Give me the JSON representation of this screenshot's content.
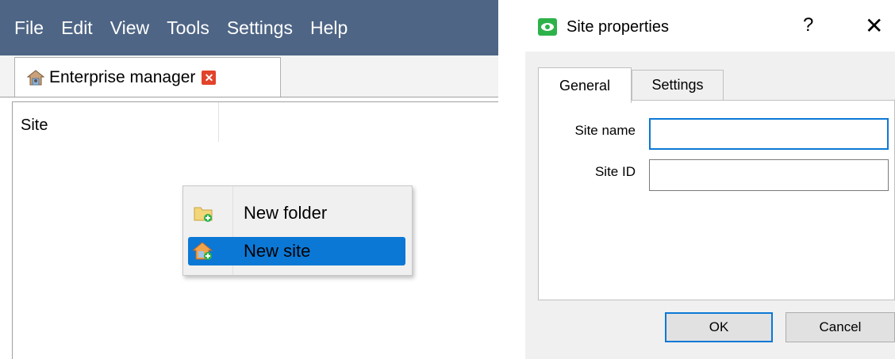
{
  "app": {
    "menu": [
      "File",
      "Edit",
      "View",
      "Tools",
      "Settings",
      "Help"
    ],
    "tab": {
      "label": "Enterprise manager",
      "close_glyph": "✕"
    },
    "column_header": "Site",
    "context_menu": [
      {
        "label": "New folder",
        "icon": "folder-add-icon"
      },
      {
        "label": "New site",
        "icon": "house-add-icon",
        "selected": true
      }
    ]
  },
  "dialog": {
    "title": "Site properties",
    "help_glyph": "?",
    "close_glyph": "✕",
    "tabs": [
      "General",
      "Settings"
    ],
    "fields": [
      {
        "label": "Site name",
        "value": ""
      },
      {
        "label": "Site ID",
        "value": ""
      }
    ],
    "buttons": {
      "ok": "OK",
      "cancel": "Cancel"
    }
  },
  "colors": {
    "menubar": "#4e6585",
    "selection": "#0b78d6",
    "close_red": "#e2432a",
    "logo_green": "#2db24a"
  }
}
